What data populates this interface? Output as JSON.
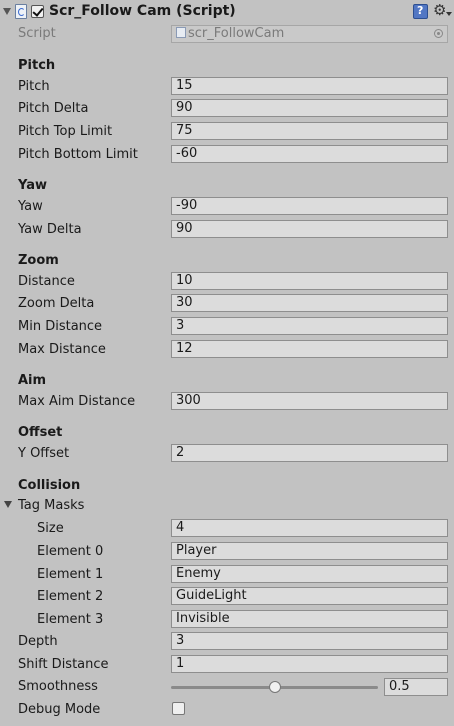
{
  "header": {
    "title": "Scr_Follow Cam (Script)"
  },
  "script": {
    "label": "Script",
    "value": "scr_FollowCam"
  },
  "sections": {
    "pitch": "Pitch",
    "yaw": "Yaw",
    "zoom": "Zoom",
    "aim": "Aim",
    "offset": "Offset",
    "collision": "Collision"
  },
  "pitch": {
    "pitch": {
      "label": "Pitch",
      "value": "15"
    },
    "pitch_delta": {
      "label": "Pitch Delta",
      "value": "90"
    },
    "top_limit": {
      "label": "Pitch Top Limit",
      "value": "75"
    },
    "bottom_limit": {
      "label": "Pitch Bottom Limit",
      "value": "-60"
    }
  },
  "yaw": {
    "yaw": {
      "label": "Yaw",
      "value": "-90"
    },
    "yaw_delta": {
      "label": "Yaw Delta",
      "value": "90"
    }
  },
  "zoom": {
    "distance": {
      "label": "Distance",
      "value": "10"
    },
    "zoom_delta": {
      "label": "Zoom Delta",
      "value": "30"
    },
    "min_distance": {
      "label": "Min Distance",
      "value": "3"
    },
    "max_distance": {
      "label": "Max Distance",
      "value": "12"
    }
  },
  "aim": {
    "max_aim_distance": {
      "label": "Max Aim Distance",
      "value": "300"
    }
  },
  "offset": {
    "y_offset": {
      "label": "Y Offset",
      "value": "2"
    }
  },
  "collision": {
    "tag_masks_label": "Tag Masks",
    "size": {
      "label": "Size",
      "value": "4"
    },
    "elements": [
      {
        "label": "Element 0",
        "value": "Player"
      },
      {
        "label": "Element 1",
        "value": "Enemy"
      },
      {
        "label": "Element 2",
        "value": "GuideLight"
      },
      {
        "label": "Element 3",
        "value": "Invisible"
      }
    ],
    "depth": {
      "label": "Depth",
      "value": "3"
    },
    "shift_distance": {
      "label": "Shift Distance",
      "value": "1"
    },
    "smoothness": {
      "label": "Smoothness",
      "value": "0.5",
      "fraction": 0.5
    },
    "debug_mode": {
      "label": "Debug Mode",
      "checked": false
    }
  }
}
